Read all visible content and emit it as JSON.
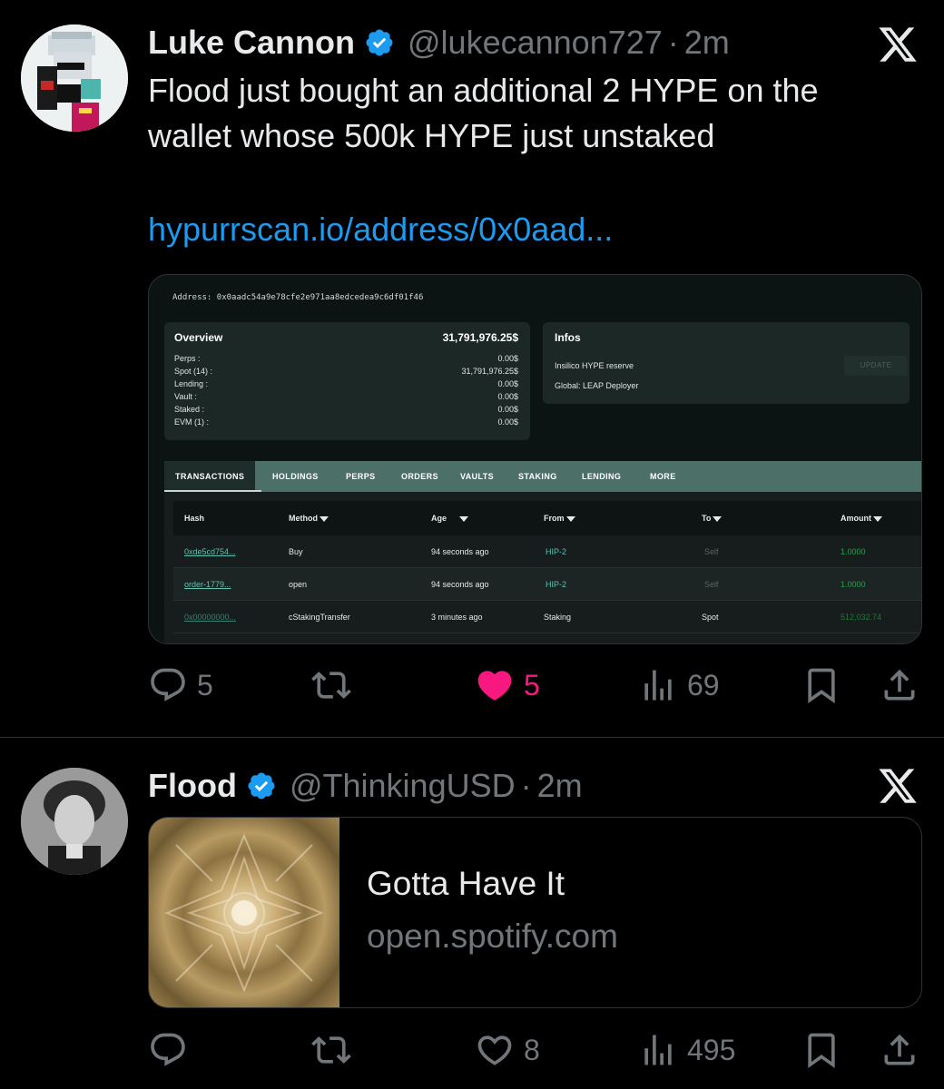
{
  "tweet1": {
    "name": "Luke Cannon",
    "handle": "@lukecannon727",
    "separator": "·",
    "time": "2m",
    "text_line1": "Flood just bought an additional 2 HYPE on the",
    "text_line2": "wallet whose 500k HYPE just unstaked",
    "link": "hypurrscan.io/address/0x0aad...",
    "embed": {
      "address_label": "Address:",
      "address": "0x0aadc54a9e78cfe2e971aa8edcedea9c6df01f46",
      "overview": {
        "title": "Overview",
        "total": "31,791,976.25$",
        "rows": [
          {
            "label": "Perps :",
            "value": "0.00$"
          },
          {
            "label": "Spot (14) :",
            "value": "31,791,976.25$"
          },
          {
            "label": "Lending :",
            "value": "0.00$"
          },
          {
            "label": "Vault :",
            "value": "0.00$"
          },
          {
            "label": "Staked :",
            "value": "0.00$"
          },
          {
            "label": "EVM (1) :",
            "value": "0.00$"
          }
        ]
      },
      "infos": {
        "title": "Infos",
        "line1": "Insilico HYPE reserve",
        "line2": "Global: LEAP Deployer",
        "update_label": "UPDATE"
      },
      "tabs": [
        "TRANSACTIONS",
        "HOLDINGS",
        "PERPS",
        "ORDERS",
        "VAULTS",
        "STAKING",
        "LENDING",
        "MORE"
      ],
      "columns": [
        "Hash",
        "Method",
        "Age",
        "From",
        "To",
        "Amount"
      ],
      "rows": [
        {
          "hash": "0xde5cd754...",
          "method": "Buy",
          "age": "94 seconds ago",
          "from": "HIP-2",
          "to": "Self",
          "amount": "1.0000"
        },
        {
          "hash": "order-1779...",
          "method": "open",
          "age": "94 seconds ago",
          "from": "HIP-2",
          "to": "Self",
          "amount": "1.0000"
        },
        {
          "hash": "0x00000000...",
          "method": "cStakingTransfer",
          "age": "3 minutes ago",
          "from": "Staking",
          "to": "Spot",
          "amount": "512,032.74"
        }
      ]
    },
    "actions": {
      "replies": "5",
      "reposts": "",
      "likes": "5",
      "views": "69"
    },
    "colors": {
      "like_active": "#f91880"
    }
  },
  "tweet2": {
    "name": "Flood",
    "handle": "@ThinkingUSD",
    "separator": "·",
    "time": "2m",
    "card": {
      "title": "Gotta Have It",
      "domain": "open.spotify.com"
    },
    "actions": {
      "replies": "",
      "reposts": "",
      "likes": "8",
      "views": "495"
    }
  },
  "icons": [
    "verified-badge-icon",
    "x-logo-icon",
    "reply-icon",
    "repost-icon",
    "like-icon",
    "views-icon",
    "bookmark-icon",
    "share-icon"
  ]
}
